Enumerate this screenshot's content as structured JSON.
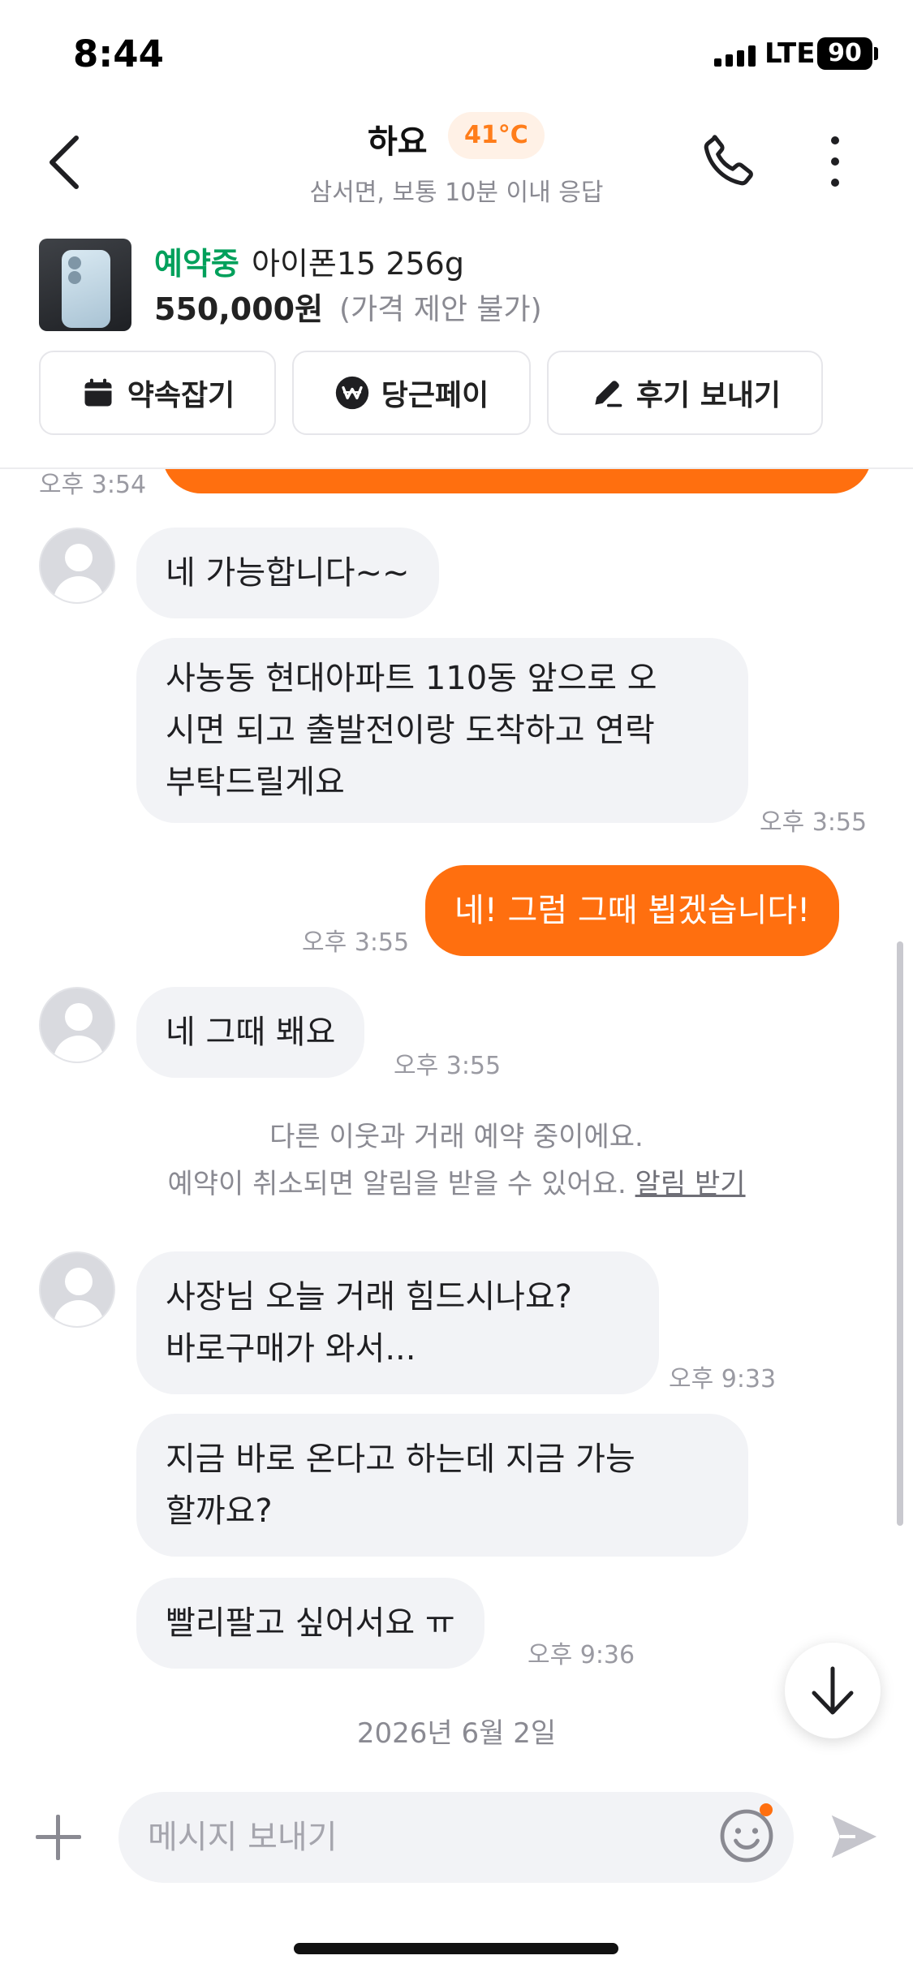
{
  "status_bar": {
    "time": "8:44",
    "network": "LTE",
    "battery": "90"
  },
  "header": {
    "name": "하요",
    "temperature": "41°C",
    "subtitle": "삼서면, 보통 10분 이내 응답"
  },
  "product": {
    "status": "예약중",
    "title": "아이폰15 256g",
    "price": "550,000원",
    "price_note": "(가격 제안 불가)"
  },
  "actions": [
    {
      "label": "약속잡기",
      "icon": "calendar-icon"
    },
    {
      "label": "당근페이",
      "icon": "won-pay-icon"
    },
    {
      "label": "후기 보내기",
      "icon": "pencil-icon"
    }
  ],
  "chat": {
    "top_partial_time": "오후 3:54",
    "messages": [
      {
        "dir": "in",
        "text": "네 가능합니다~~",
        "time": ""
      },
      {
        "dir": "in",
        "lines": [
          "사농동 현대아파트 110동 앞으로 오",
          "시면 되고 출발전이랑 도착하고 연락",
          "부탁드릴게요"
        ],
        "time": "오후 3:55"
      },
      {
        "dir": "out",
        "text": "네! 그럼 그때 뵙겠습니다!",
        "time": "오후 3:55"
      },
      {
        "dir": "in",
        "text": "네 그때 봬요",
        "time": "오후 3:55"
      },
      {
        "dir": "in",
        "lines": [
          "사장님 오늘 거래 힘드시나요?",
          "바로구매가 와서..."
        ],
        "time": "오후 9:33"
      },
      {
        "dir": "in",
        "lines": [
          "지금 바로 온다고 하는데 지금 가능",
          "할까요?"
        ],
        "time": ""
      },
      {
        "dir": "in",
        "text": "빨리팔고 싶어서요 ㅠ",
        "time": "오후 9:36"
      }
    ],
    "notice_line1": "다른 이웃과 거래 예약 중이에요.",
    "notice_line2": "예약이 취소되면 알림을 받을 수 있어요.",
    "notice_link": "알림 받기",
    "date_separator": "2026년 6월 2일"
  },
  "input": {
    "placeholder": "메시지 보내기"
  },
  "colors": {
    "accent": "#ff6f0f",
    "reserved": "#00a05b",
    "bubble_in": "#f2f3f6"
  }
}
